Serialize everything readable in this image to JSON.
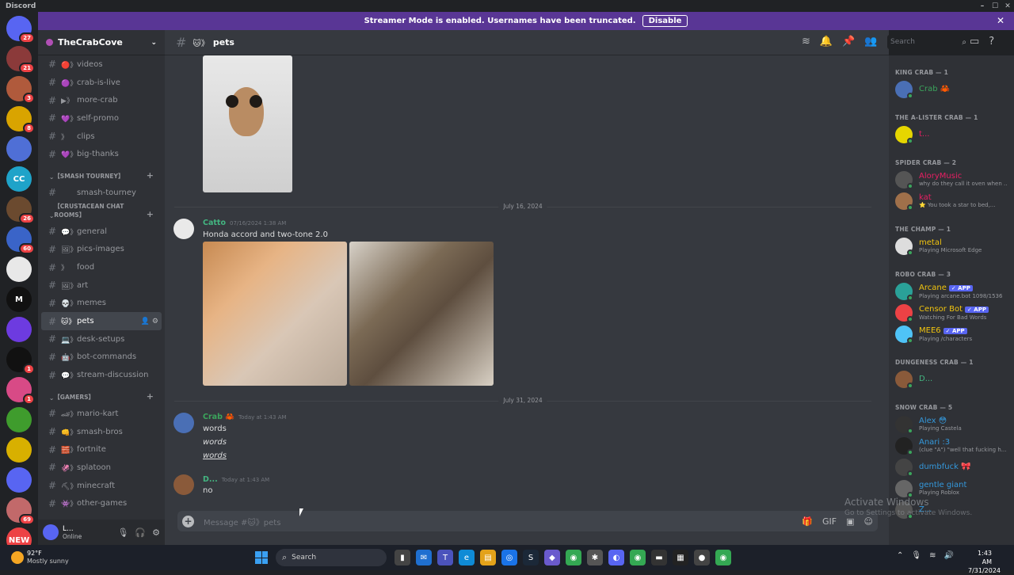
{
  "window": {
    "app_title": "Discord"
  },
  "banner": {
    "text": "Streamer Mode is enabled. Usernames have been truncated.",
    "button": "Disable"
  },
  "servers": [
    {
      "label": "",
      "color": "#5865f2",
      "badge": "27"
    },
    {
      "label": "",
      "color": "#8b3a3a",
      "badge": "21"
    },
    {
      "label": "",
      "color": "#b05a3c",
      "badge": "3"
    },
    {
      "label": "",
      "color": "#d9a400",
      "badge": "8"
    },
    {
      "label": "",
      "color": "#4f6fd6",
      "badge": ""
    },
    {
      "label": "CC",
      "color": "#1fa3c9",
      "badge": ""
    },
    {
      "label": "",
      "color": "#6b4a2f",
      "badge": "26"
    },
    {
      "label": "",
      "color": "#3a64c8",
      "badge": "60"
    },
    {
      "label": "",
      "color": "#e8e8e8",
      "badge": ""
    },
    {
      "label": "M",
      "color": "#111111",
      "badge": ""
    },
    {
      "label": "",
      "color": "#6d3be0",
      "badge": ""
    },
    {
      "label": "",
      "color": "#111111",
      "badge": "1"
    },
    {
      "label": "",
      "color": "#d84a86",
      "badge": "1"
    },
    {
      "label": "",
      "color": "#3f9c2d",
      "badge": ""
    },
    {
      "label": "",
      "color": "#d8b000",
      "badge": ""
    },
    {
      "label": "",
      "color": "#5865f2",
      "badge": ""
    },
    {
      "label": "",
      "color": "#c2696a",
      "badge": "69"
    },
    {
      "label": "NEW",
      "color": "#ed4245",
      "badge": ""
    }
  ],
  "guild": {
    "name": "TheCrabCove"
  },
  "channels": {
    "top": [
      {
        "name": "videos",
        "emoji": "🔴》"
      },
      {
        "name": "crab-is-live",
        "emoji": "🟣》"
      },
      {
        "name": "more-crab",
        "emoji": "▶》"
      },
      {
        "name": "self-promo",
        "emoji": "💜》"
      },
      {
        "name": "clips",
        "emoji": "》"
      },
      {
        "name": "big-thanks",
        "emoji": "💜》"
      }
    ],
    "smash_cat": "【SMASH TOURNEY】",
    "smash": [
      {
        "name": "smash-tourney",
        "emoji": ""
      }
    ],
    "chat_cat": "【CRUSTACEAN CHAT ROOMS】",
    "chat": [
      {
        "name": "general",
        "emoji": "💬》"
      },
      {
        "name": "pics-images",
        "emoji": "🖼》"
      },
      {
        "name": "food",
        "emoji": "》"
      },
      {
        "name": "art",
        "emoji": "🖼》"
      },
      {
        "name": "memes",
        "emoji": "💀》"
      },
      {
        "name": "pets",
        "emoji": "🐱》"
      },
      {
        "name": "desk-setups",
        "emoji": "💻》"
      },
      {
        "name": "bot-commands",
        "emoji": "🤖》"
      },
      {
        "name": "stream-discussion",
        "emoji": "💬》"
      }
    ],
    "gamers_cat": "【GAMERS】",
    "gamers": [
      {
        "name": "mario-kart",
        "emoji": "🏎》"
      },
      {
        "name": "smash-bros",
        "emoji": "👊》"
      },
      {
        "name": "fortnite",
        "emoji": "🧱》"
      },
      {
        "name": "splatoon",
        "emoji": "🦑》"
      },
      {
        "name": "minecraft",
        "emoji": "⛏》"
      },
      {
        "name": "other-games",
        "emoji": "👾》"
      }
    ]
  },
  "user": {
    "name": "L...",
    "status": "Online"
  },
  "channel_header": {
    "emoji": "🐱》",
    "name": "pets"
  },
  "search": {
    "placeholder": "Search"
  },
  "messages": {
    "date1": "July 16, 2024",
    "m1": {
      "author": "Catto",
      "time": "07/16/2024 1:38 AM",
      "text": "Honda accord and two-tone 2.0",
      "author_color": "#43b581"
    },
    "date2": "July 31, 2024",
    "m2": {
      "author": "Crab",
      "time": "Today at 1:43 AM",
      "lines": [
        "words",
        "words",
        "words"
      ],
      "author_color": "#3ba55c"
    },
    "m3": {
      "author": "D...",
      "time": "Today at 1:43 AM",
      "text": "no",
      "author_color": "#43b581"
    }
  },
  "composer": {
    "placeholder": "Message #🐱》pets"
  },
  "members": {
    "groups": [
      {
        "title": "KING CRAB — 1",
        "members": [
          {
            "name": "Crab 🦀",
            "sub": "",
            "color": "#3ba55c",
            "av": "#4a6fb5"
          }
        ]
      },
      {
        "title": "THE A-LISTER CRAB — 1",
        "members": [
          {
            "name": "t...",
            "sub": "",
            "color": "#e91e63",
            "av": "#e6d600"
          }
        ]
      },
      {
        "title": "SPIDER CRAB — 2",
        "members": [
          {
            "name": "AloryMusic",
            "sub": "why do they call it oven when ...",
            "color": "#e91e63",
            "av": "#555555"
          },
          {
            "name": "kat",
            "sub": "⭐ You took a star to bed,...",
            "color": "#e91e63",
            "av": "#a0704a"
          }
        ]
      },
      {
        "title": "THE CHAMP — 1",
        "members": [
          {
            "name": "metal",
            "sub": "Playing Microsoft Edge",
            "color": "#f1c40f",
            "av": "#dddddd"
          }
        ]
      },
      {
        "title": "ROBO CRAB — 3",
        "members": [
          {
            "name": "Arcane",
            "sub": "Playing arcane.bot 1098/1536",
            "color": "#f1c40f",
            "av": "#2aa198",
            "app": "✓ APP"
          },
          {
            "name": "Censor Bot",
            "sub": "Watching For Bad Words",
            "color": "#f1c40f",
            "av": "#ed4245",
            "app": "✓ APP"
          },
          {
            "name": "MEE6",
            "sub": "Playing /characters",
            "color": "#f1c40f",
            "av": "#4fc3f7",
            "app": "✓ APP"
          }
        ]
      },
      {
        "title": "DUNGENESS CRAB — 1",
        "members": [
          {
            "name": "D...",
            "sub": "",
            "color": "#43b581",
            "av": "#8a5a3a"
          }
        ]
      },
      {
        "title": "SNOW CRAB — 5",
        "members": [
          {
            "name": "Alex 😳",
            "sub": "Playing Castela",
            "color": "#3498db",
            "av": "#333333"
          },
          {
            "name": "Anari :3",
            "sub": "(clue \"A\") \"well that fucking h...",
            "color": "#3498db",
            "av": "#222222"
          },
          {
            "name": "dumbfuck 🎀",
            "sub": "",
            "color": "#3498db",
            "av": "#444444"
          },
          {
            "name": "gentle giant",
            "sub": "Playing Roblox",
            "color": "#3498db",
            "av": "#666666"
          },
          {
            "name": "Z...",
            "sub": "",
            "color": "#3498db",
            "av": "#555555"
          }
        ]
      }
    ]
  },
  "watermark": {
    "line1": "Activate Windows",
    "line2": "Go to Settings to activate Windows."
  },
  "taskbar": {
    "temp": "92°F",
    "weather": "Mostly sunny",
    "search": "Search",
    "time": "1:43 AM",
    "date": "7/31/2024"
  }
}
